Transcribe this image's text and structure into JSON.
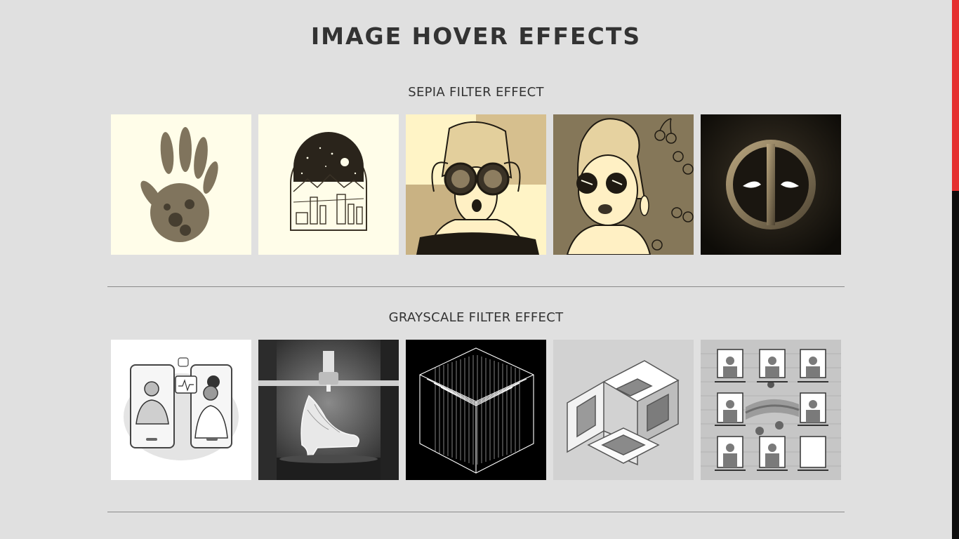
{
  "page": {
    "title": "IMAGE HOVER EFFECTS"
  },
  "sections": [
    {
      "title": "SEPIA FILTER EFFECT",
      "images": [
        "handprint-image",
        "mountain-night-badge-image",
        "woman-binoculars-image",
        "woman-sunglasses-cherries-image",
        "deadpool-logo-image"
      ]
    },
    {
      "title": "GRAYSCALE FILTER EFFECT",
      "images": [
        "doctor-video-call-image",
        "3d-printed-shoe-image",
        "line-cube-image",
        "impossible-cube-image",
        "windows-neighbors-image"
      ]
    }
  ],
  "colors": {
    "background": "#e0e0e0",
    "sepia_light": "#fffde9",
    "scroll_thumb": "#e53030",
    "scroll_track": "#0d0d0d"
  }
}
